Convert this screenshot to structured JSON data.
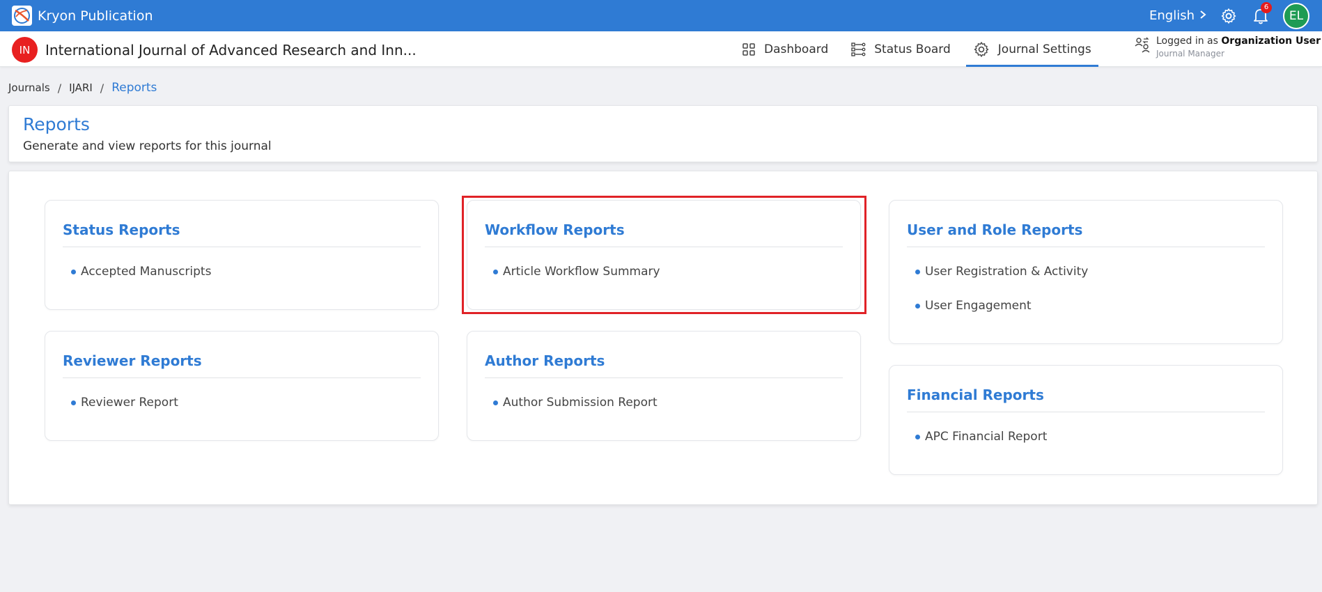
{
  "topbar": {
    "brand_name": "Kryon Publication",
    "language": "English",
    "notification_count": "6",
    "avatar_initials": "EL",
    "brand_color": "#2f7bd4"
  },
  "subheader": {
    "journal_initials": "IN",
    "journal_title": "International Journal of Advanced Research and Inn...",
    "nav": [
      {
        "label": "Dashboard",
        "icon": "grid-icon"
      },
      {
        "label": "Status Board",
        "icon": "status-board-icon"
      },
      {
        "label": "Journal Settings",
        "icon": "gear-icon"
      }
    ],
    "active_nav": "Journal Settings",
    "user": {
      "logged_in_prefix": "Logged in as",
      "name": "Organization User",
      "role": "Journal Manager"
    }
  },
  "breadcrumb": {
    "items": [
      "Journals",
      "IJARI",
      "Reports"
    ]
  },
  "page": {
    "title": "Reports",
    "subtitle": "Generate and view reports for this journal"
  },
  "reports": {
    "status": {
      "title": "Status Reports",
      "items": [
        "Accepted Manuscripts"
      ]
    },
    "workflow": {
      "title": "Workflow Reports",
      "items": [
        "Article Workflow Summary"
      ]
    },
    "user_role": {
      "title": "User and Role Reports",
      "items": [
        "User Registration & Activity",
        "User Engagement"
      ]
    },
    "reviewer": {
      "title": "Reviewer Reports",
      "items": [
        "Reviewer Report"
      ]
    },
    "author": {
      "title": "Author Reports",
      "items": [
        "Author Submission Report"
      ]
    },
    "financial": {
      "title": "Financial Reports",
      "items": [
        "APC Financial Report"
      ]
    }
  },
  "highlight_color": "#e02227"
}
